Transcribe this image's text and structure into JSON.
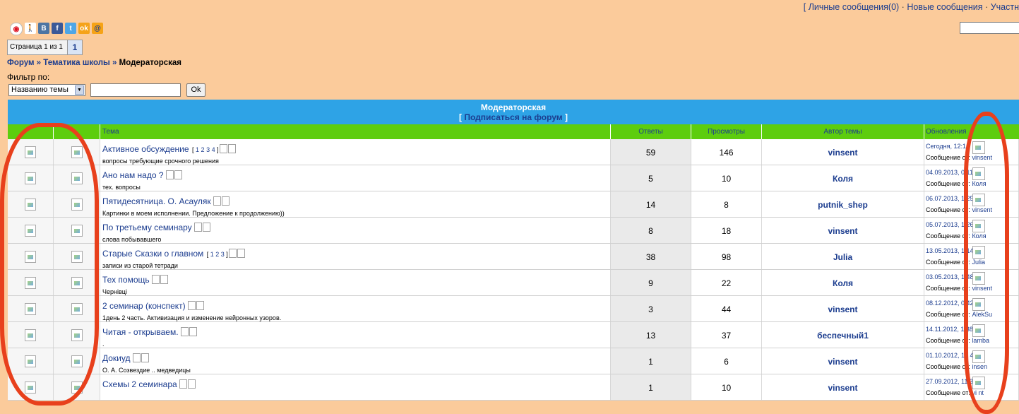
{
  "header": {
    "links": [
      "Личные сообщения(0)",
      "Новые сообщения",
      "Участн"
    ]
  },
  "social_icons": [
    "vk-icon",
    "facebook-icon",
    "twitter-icon",
    "odnoklassniki-icon",
    "mail-icon"
  ],
  "pager": {
    "info": "Страница 1 из 1",
    "current": "1"
  },
  "breadcrumb": {
    "forum": "Форум",
    "sep": "»",
    "category": "Тематика школы",
    "current": "Модераторская"
  },
  "filter": {
    "label": "Фильтр по:",
    "selected": "Названию темы",
    "button": "Ok"
  },
  "forum": {
    "title": "Модераторская",
    "subscribe": "Подписаться на форум"
  },
  "columns": {
    "topic": "Тема",
    "replies": "Ответы",
    "views": "Просмотры",
    "author": "Автор темы",
    "updates": "Обновления"
  },
  "rows": [
    {
      "title": "Активное обсуждение",
      "pages": [
        "1",
        "2",
        "3",
        "4"
      ],
      "desc": "вопросы требующие срочного решения",
      "replies": "59",
      "views": "146",
      "author": "vinsent",
      "date": "Сегодня, 12:1",
      "msg": "Сообщение от:",
      "last": "vinsent"
    },
    {
      "title": "Ано нам надо ?",
      "pages": [],
      "desc": "тех. вопросы",
      "replies": "5",
      "views": "10",
      "author": "Коля",
      "date": "04.09.2013, 0 11",
      "msg": "Сообщение от:",
      "last": "Коля"
    },
    {
      "title": "Пятидесятница. О. Асауляк",
      "pages": [],
      "desc": "Картинки в моем исполнении. Предложение к продолжению))",
      "replies": "14",
      "views": "8",
      "author": "putnik_shep",
      "date": "06.07.2013, 1 25",
      "msg": "Сообщение от:",
      "last": "vinsent"
    },
    {
      "title": "По третьему семинару",
      "pages": [],
      "desc": "слова побывавшего",
      "replies": "8",
      "views": "18",
      "author": "vinsent",
      "date": "05.07.2013, 1 26",
      "msg": "Сообщение от:",
      "last": "Коля"
    },
    {
      "title": "Старые Сказки о главном",
      "pages": [
        "1",
        "2",
        "3"
      ],
      "desc": "записи из старой тетради",
      "replies": "38",
      "views": "98",
      "author": "Julia",
      "date": "13.05.2013, 1 14",
      "msg": "Сообщение от:",
      "last": "Julia"
    },
    {
      "title": "Тех помощь",
      "pages": [],
      "desc": "Чернівці",
      "replies": "9",
      "views": "22",
      "author": "Коля",
      "date": "03.05.2013, 1 48",
      "msg": "Сообщение от:",
      "last": "vinsent"
    },
    {
      "title": "2 семинар (конспект)",
      "pages": [],
      "desc": "1день 2 часть. Активизация и изменение нейронных узоров.",
      "replies": "3",
      "views": "44",
      "author": "vinsent",
      "date": "08.12.2012, 0 42",
      "msg": "Сообщение от:",
      "last": "AlekSu"
    },
    {
      "title": "Читая - открываем.",
      "pages": [],
      "desc": ".",
      "replies": "13",
      "views": "37",
      "author": "беспечный1",
      "date": "14.11.2012, 1 38",
      "msg": "Сообщение от:",
      "last": "lamba"
    },
    {
      "title": "Докиуд",
      "pages": [],
      "desc": "О. А. Созвездие .. медведицы",
      "replies": "1",
      "views": "6",
      "author": "vinsent",
      "date": "01.10.2012, 18 4",
      "msg": "Сообщение от:",
      "last": "insen"
    },
    {
      "title": "Схемы 2 семинара",
      "pages": [],
      "desc": "",
      "replies": "1",
      "views": "10",
      "author": "vinsent",
      "date": "27.09.2012, 11:3",
      "msg": "Сообщение от:",
      "last": "vi nt"
    }
  ]
}
